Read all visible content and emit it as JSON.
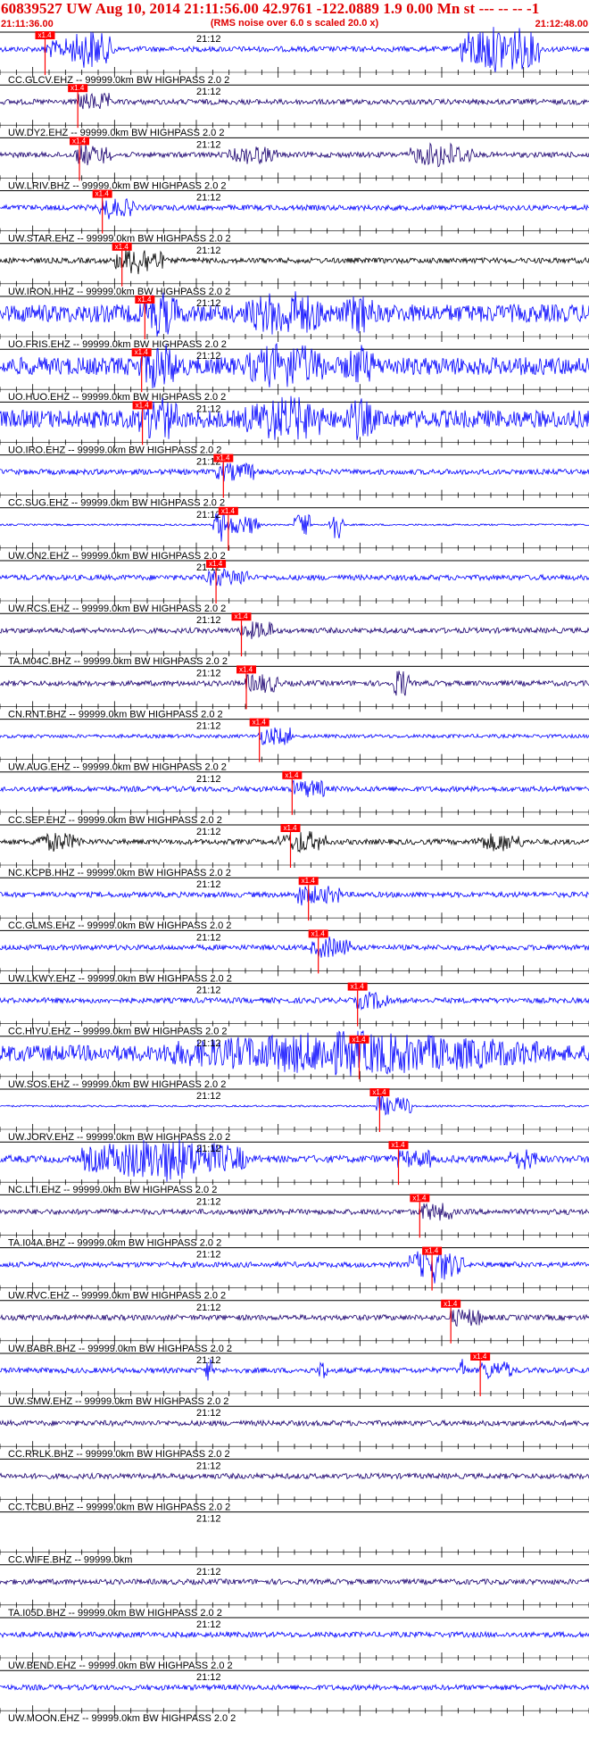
{
  "header": {
    "title": "60839527 UW Aug 10, 2014 21:11:56.00   42.9761 -122.0889  1.9 0.00 Mn st --- -- --   -1",
    "subtitle": "(RMS noise over 6.0 s scaled 20.0 x)",
    "start_time": "21:11:36.00",
    "end_time": "21:12:48.00"
  },
  "colors": {
    "title": "#e00000",
    "blue_trace": "#0000ff",
    "dark_blue_trace": "#1a0070",
    "black_trace": "#000000",
    "pick_marker": "#ff0000"
  },
  "chart_data": {
    "type": "seismogram",
    "time_axis": {
      "start": "21:11:36.00",
      "end": "21:12:48.00",
      "tick_label": "21:12"
    },
    "pick_label": "x1.4",
    "traces": [
      {
        "name": "CC.GLCV.EHZ",
        "label": "CC.GLCV.EHZ -- 99999.0km BW  HIGHPASS  2.0  2",
        "color": "blue",
        "pick_time_s": 5.4
      },
      {
        "name": "UW.DY2.EHZ",
        "label": "UW.DY2.EHZ -- 99999.0km BW  HIGHPASS  2.0  2",
        "color": "dark_blue",
        "pick_time_s": 9.4
      },
      {
        "name": "UW.LRIV.BHZ",
        "label": "UW.LRIV.BHZ -- 99999.0km BW  HIGHPASS  2.0  2",
        "color": "dark_blue",
        "pick_time_s": 9.6
      },
      {
        "name": "UW.STAR.EHZ",
        "label": "UW.STAR.EHZ -- 99999.0km BW  HIGHPASS  2.0  2",
        "color": "blue",
        "pick_time_s": 12.4
      },
      {
        "name": "UW.IRON.HHZ",
        "label": "UW.IRON.HHZ -- 99999.0km BW  HIGHPASS  2.0  2",
        "color": "black",
        "pick_time_s": 14.8
      },
      {
        "name": "UO.FRIS.EHZ",
        "label": "UO.FRIS.EHZ -- 99999.0km BW  HIGHPASS  2.0  2",
        "color": "blue",
        "pick_time_s": 17.6
      },
      {
        "name": "UO.HUO.EHZ",
        "label": "UO.HUO.EHZ -- 99999.0km BW  HIGHPASS  2.0  2",
        "color": "blue",
        "pick_time_s": 17.2
      },
      {
        "name": "UO.IRO.EHZ",
        "label": "UO.IRO.EHZ -- 99999.0km BW  HIGHPASS  2.0  2",
        "color": "blue",
        "pick_time_s": 17.3
      },
      {
        "name": "CC.SUG.EHZ",
        "label": "CC.SUG.EHZ -- 99999.0km BW  HIGHPASS  2.0  2",
        "color": "blue",
        "pick_time_s": 27.2
      },
      {
        "name": "UW.ON2.EHZ",
        "label": "UW.ON2.EHZ -- 99999.0km BW  HIGHPASS  2.0  2",
        "color": "blue",
        "pick_time_s": 27.8
      },
      {
        "name": "UW.RCS.EHZ",
        "label": "UW.RCS.EHZ -- 99999.0km BW  HIGHPASS  2.0  2",
        "color": "blue",
        "pick_time_s": 26.3
      },
      {
        "name": "TA.M04C.BHZ",
        "label": "TA.M04C.BHZ -- 99999.0km BW  HIGHPASS  2.0  2",
        "color": "dark_blue",
        "pick_time_s": 29.4
      },
      {
        "name": "CN.RNT.BHZ",
        "label": "CN.RNT.BHZ -- 99999.0km BW  HIGHPASS  2.0  2",
        "color": "dark_blue",
        "pick_time_s": 30.0
      },
      {
        "name": "UW.AUG.EHZ",
        "label": "UW.AUG.EHZ -- 99999.0km BW  HIGHPASS  2.0  2",
        "color": "blue",
        "pick_time_s": 31.6
      },
      {
        "name": "CC.SEP.EHZ",
        "label": "CC.SEP.EHZ -- 99999.0km BW  HIGHPASS  2.0  2",
        "color": "blue",
        "pick_time_s": 35.6
      },
      {
        "name": "NC.KCPB.HHZ",
        "label": "NC.KCPB.HHZ -- 99999.0km BW  HIGHPASS  2.0  2",
        "color": "black",
        "pick_time_s": 35.4
      },
      {
        "name": "CC.GLMS.EHZ",
        "label": "CC.GLMS.EHZ -- 99999.0km BW  HIGHPASS  2.0  2",
        "color": "blue",
        "pick_time_s": 37.6
      },
      {
        "name": "UW.LKWY.EHZ",
        "label": "UW.LKWY.EHZ -- 99999.0km BW  HIGHPASS  2.0  2",
        "color": "blue",
        "pick_time_s": 38.8
      },
      {
        "name": "CC.HIYU.EHZ",
        "label": "CC.HIYU.EHZ -- 99999.0km BW  HIGHPASS  2.0  2",
        "color": "blue",
        "pick_time_s": 43.6
      },
      {
        "name": "UW.SOS.EHZ",
        "label": "UW.SOS.EHZ -- 99999.0km BW  HIGHPASS  2.0  2",
        "color": "blue",
        "pick_time_s": 43.8
      },
      {
        "name": "UW.JORV.EHZ",
        "label": "UW.JORV.EHZ -- 99999.0km BW  HIGHPASS  2.0  2",
        "color": "blue",
        "pick_time_s": 46.3
      },
      {
        "name": "NC.LTI.EHZ",
        "label": "NC.LTI.EHZ -- 99999.0km BW  HIGHPASS  2.0  2",
        "color": "blue",
        "pick_time_s": 48.6
      },
      {
        "name": "TA.I04A.BHZ",
        "label": "TA.I04A.BHZ -- 99999.0km BW  HIGHPASS  2.0  2",
        "color": "dark_blue",
        "pick_time_s": 51.2
      },
      {
        "name": "UW.RVC.EHZ",
        "label": "UW.RVC.EHZ -- 99999.0km BW  HIGHPASS  2.0  2",
        "color": "blue",
        "pick_time_s": 52.7
      },
      {
        "name": "UW.BABR.BHZ",
        "label": "UW.BABR.BHZ -- 99999.0km BW  HIGHPASS  2.0  2",
        "color": "dark_blue",
        "pick_time_s": 55.0
      },
      {
        "name": "UW.SMW.EHZ",
        "label": "UW.SMW.EHZ -- 99999.0km BW  HIGHPASS  2.0  2",
        "color": "blue",
        "pick_time_s": 58.6
      },
      {
        "name": "CC.RRLK.BHZ",
        "label": "CC.RRLK.BHZ -- 99999.0km BW  HIGHPASS  2.0  2",
        "color": "dark_blue"
      },
      {
        "name": "CC.TCBU.BHZ",
        "label": "CC.TCBU.BHZ -- 99999.0km BW  HIGHPASS  2.0  2",
        "color": "dark_blue"
      },
      {
        "name": "CC.WIFE.BHZ",
        "label": "CC.WIFE.BHZ -- 99999.0km",
        "color": "none"
      },
      {
        "name": "TA.I05D.BHZ",
        "label": "TA.I05D.BHZ -- 99999.0km BW  HIGHPASS  2.0  2",
        "color": "dark_blue"
      },
      {
        "name": "UW.BEND.EHZ",
        "label": "UW.BEND.EHZ -- 99999.0km BW  HIGHPASS  2.0  2",
        "color": "blue"
      },
      {
        "name": "UW.MOON.EHZ",
        "label": "UW.MOON.EHZ -- 99999.0km BW  HIGHPASS  2.0  2",
        "color": "blue"
      }
    ]
  }
}
